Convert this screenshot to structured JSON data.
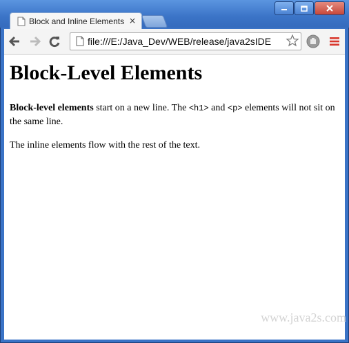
{
  "window": {
    "controls": [
      "minimize",
      "maximize",
      "close"
    ]
  },
  "tab": {
    "title": "Block and Inline Elements",
    "close_glyph": "×",
    "icon": "page-icon"
  },
  "toolbar": {
    "back_icon": "arrow-left-icon",
    "forward_icon": "arrow-right-icon",
    "reload_icon": "reload-icon",
    "url": "file:///E:/Java_Dev/WEB/release/java2sIDE",
    "star_icon": "star-icon",
    "extension_icon": "adblock-icon",
    "menu_icon": "menu-icon"
  },
  "content": {
    "heading": "Block-Level Elements",
    "para1_bold": "Block-level elements",
    "para1_text1": " start on a new line. The ",
    "code_h1": "<h1>",
    "para1_text2": " and ",
    "code_p": "<p>",
    "para1_text3": " elements will not sit on the same line.",
    "para2": "The inline elements flow with the rest of the text."
  },
  "watermark": "www.java2s.com",
  "colors": {
    "frame_blue": "#3a73c6",
    "menu_red": "#d9362b"
  }
}
